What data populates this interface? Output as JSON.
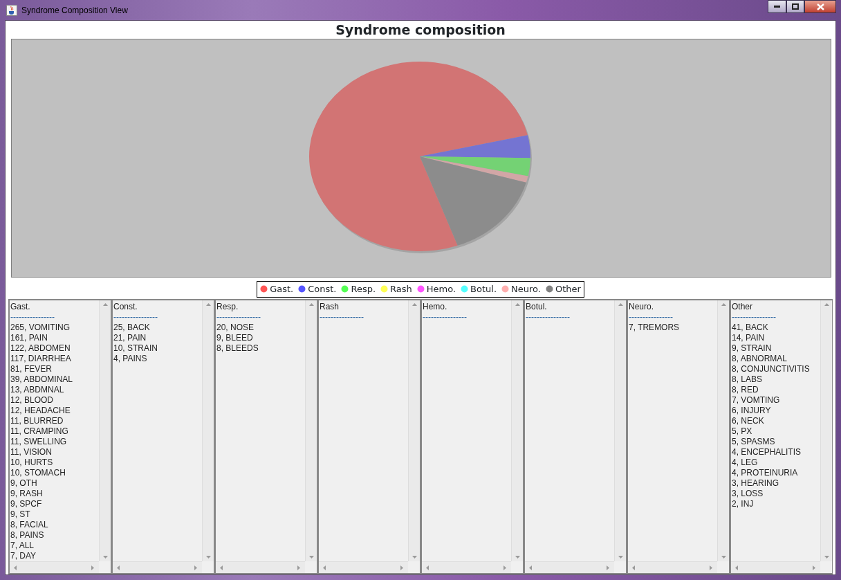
{
  "window": {
    "title": "Syndrome Composition View"
  },
  "chart": {
    "title": "Syndrome composition"
  },
  "legend": [
    {
      "label": "Gast.",
      "color": "#ff5555"
    },
    {
      "label": "Const.",
      "color": "#5555ff"
    },
    {
      "label": "Resp.",
      "color": "#55ff55"
    },
    {
      "label": "Rash",
      "color": "#ffff55"
    },
    {
      "label": "Hemo.",
      "color": "#ff55ff"
    },
    {
      "label": "Botul.",
      "color": "#55ffff"
    },
    {
      "label": "Neuro.",
      "color": "#ffafaf"
    },
    {
      "label": "Other",
      "color": "#808080"
    }
  ],
  "lists": [
    {
      "header": "Gast.",
      "separator": "----------------",
      "items": [
        "265, VOMITING",
        "161, PAIN",
        "122, ABDOMEN",
        "117, DIARRHEA",
        "81, FEVER",
        "39, ABDOMINAL",
        "13, ABDMNAL",
        "12, BLOOD",
        "12, HEADACHE",
        "11, BLURRED",
        "11, CRAMPING",
        "11, SWELLING",
        "11, VISION",
        "10, HURTS",
        "10, STOMACH",
        "9, OTH",
        "9, RASH",
        "9, SPCF",
        "9, ST",
        "8, FACIAL",
        "8, PAINS",
        "7, ALL",
        "7, DAY"
      ]
    },
    {
      "header": "Const.",
      "separator": "----------------",
      "items": [
        "25, BACK",
        "21, PAIN",
        "10, STRAIN",
        "4, PAINS"
      ]
    },
    {
      "header": "Resp.",
      "separator": "----------------",
      "items": [
        "20, NOSE",
        "9, BLEED",
        "8, BLEEDS"
      ]
    },
    {
      "header": "Rash",
      "separator": "----------------"
    },
    {
      "header": "Hemo.",
      "separator": "----------------"
    },
    {
      "header": "Botul.",
      "separator": "----------------"
    },
    {
      "header": "Neuro.",
      "separator": "----------------",
      "items": [
        "7, TREMORS"
      ]
    },
    {
      "header": "Other",
      "separator": "----------------",
      "items": [
        "41, BACK",
        "14, PAIN",
        "9, STRAIN",
        "8, ABNORMAL",
        "8, CONJUNCTIVITIS",
        "8, LABS",
        "8, RED",
        "7, VOMTING",
        "6, INJURY",
        "6, NECK",
        "5, PX",
        "5, SPASMS",
        "4, ENCEPHALITIS",
        "4, LEG",
        "4, PROTEINURIA",
        "3, HEARING",
        "3, LOSS",
        "2, INJ"
      ]
    }
  ]
}
